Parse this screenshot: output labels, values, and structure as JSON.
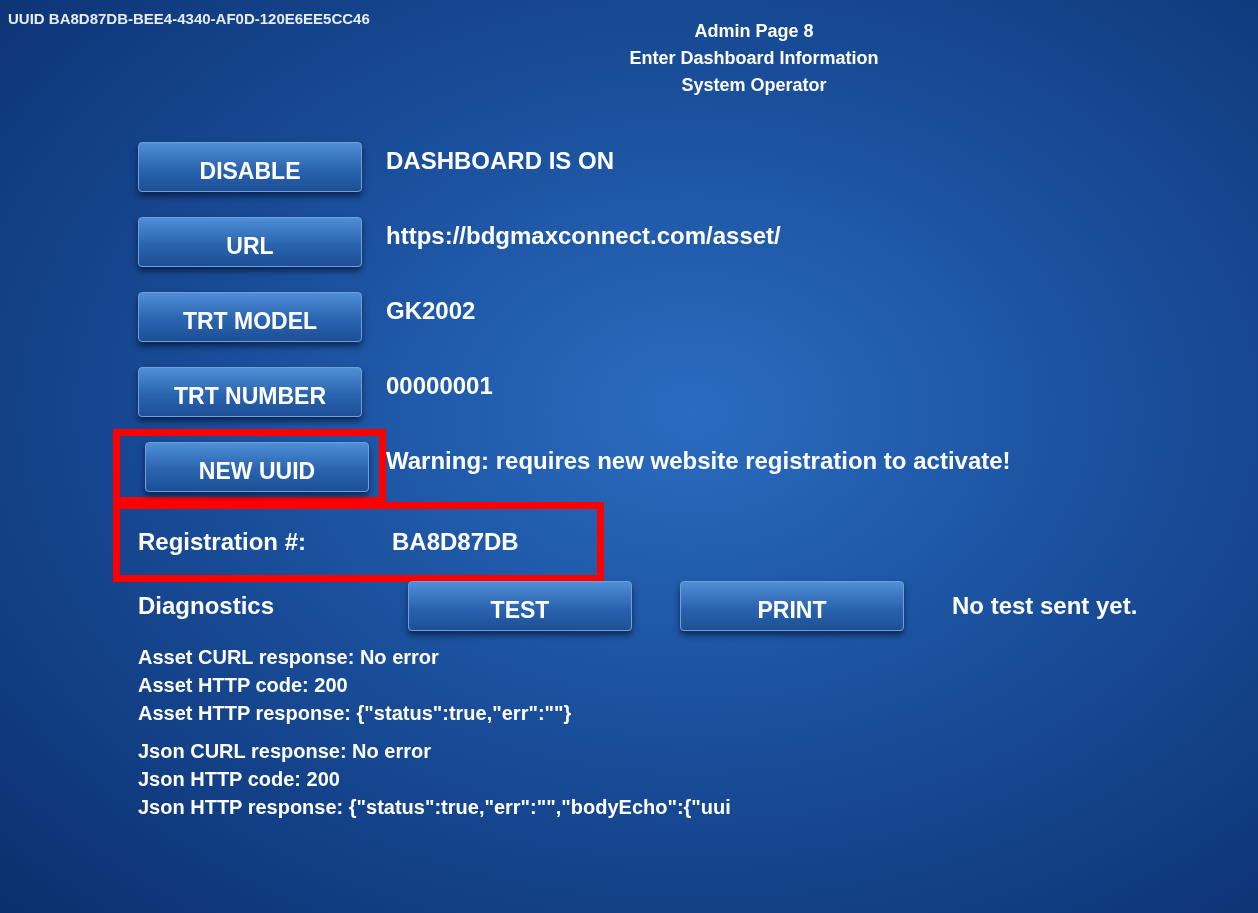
{
  "uuid_label": "UUID BA8D87DB-BEE4-4340-AF0D-120E6EE5CC46",
  "title_lines": [
    "Admin Page 8",
    "Enter Dashboard Information",
    "System Operator"
  ],
  "rows": [
    {
      "kind": "button",
      "button": "DISABLE",
      "value": "DASHBOARD IS ON",
      "highlighted": false
    },
    {
      "kind": "button",
      "button": "URL",
      "value": "https://bdgmaxconnect.com/asset/",
      "highlighted": false
    },
    {
      "kind": "button",
      "button": "TRT MODEL",
      "value": "GK2002",
      "highlighted": false
    },
    {
      "kind": "button",
      "button": "TRT NUMBER",
      "value": "00000001",
      "highlighted": false
    },
    {
      "kind": "button",
      "button": "NEW UUID",
      "value": "Warning: requires new website registration to activate!",
      "highlighted": true
    },
    {
      "kind": "label",
      "label": "Registration #:",
      "value": "BA8D87DB",
      "highlighted": true
    }
  ],
  "diagnostics": {
    "label": "Diagnostics",
    "buttons": [
      "TEST",
      "PRINT"
    ],
    "status": "No test sent yet."
  },
  "responses": [
    [
      "Asset CURL response: No error",
      "Asset HTTP code: 200",
      "Asset HTTP response: {\"status\":true,\"err\":\"\"}"
    ],
    [
      "Json CURL response: No error",
      "Json HTTP code: 200",
      "Json HTTP response: {\"status\":true,\"err\":\"\",\"bodyEcho\":{\"uui"
    ]
  ]
}
